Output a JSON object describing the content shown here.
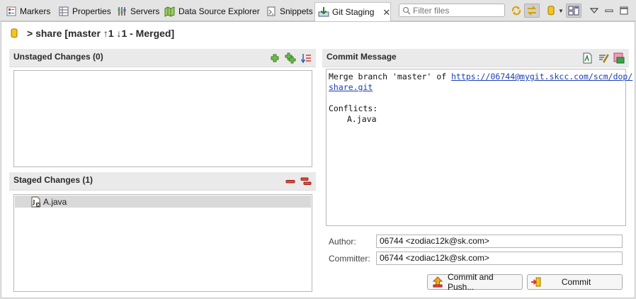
{
  "tabs": [
    {
      "label": "Markers",
      "icon": "markers-icon"
    },
    {
      "label": "Properties",
      "icon": "properties-icon"
    },
    {
      "label": "Servers",
      "icon": "servers-icon"
    },
    {
      "label": "Data Source Explorer",
      "icon": "data-source-icon"
    },
    {
      "label": "Snippets",
      "icon": "snippets-icon"
    },
    {
      "label": "Git Staging",
      "icon": "git-staging-icon",
      "active": true
    }
  ],
  "filter": {
    "placeholder": "Filter files"
  },
  "repo": {
    "title": "> share [master ↑1 ↓1 - Merged]"
  },
  "unstaged": {
    "label": "Unstaged Changes (0)"
  },
  "staged": {
    "label": "Staged Changes (1)",
    "items": [
      {
        "name": "A.java"
      }
    ]
  },
  "commit": {
    "header": "Commit Message",
    "line1_prefix": "Merge branch 'master' of ",
    "link_part1": "https://06744@mygit.skcc.com/scm/dop/",
    "link_part2": "share.git",
    "conflicts_label": "Conflicts:",
    "conflict_file": "A.java",
    "author_label": "Author:",
    "author_value": "06744 <zodiac12k@sk.com>",
    "committer_label": "Committer:",
    "committer_value": "06744 <zodiac12k@sk.com>",
    "commit_push_label": "Commit and Push...",
    "commit_label": "Commit"
  },
  "colors": {
    "accent_green": "#4caf3a",
    "remove_red": "#d9302a",
    "link": "#1a3fb5"
  }
}
